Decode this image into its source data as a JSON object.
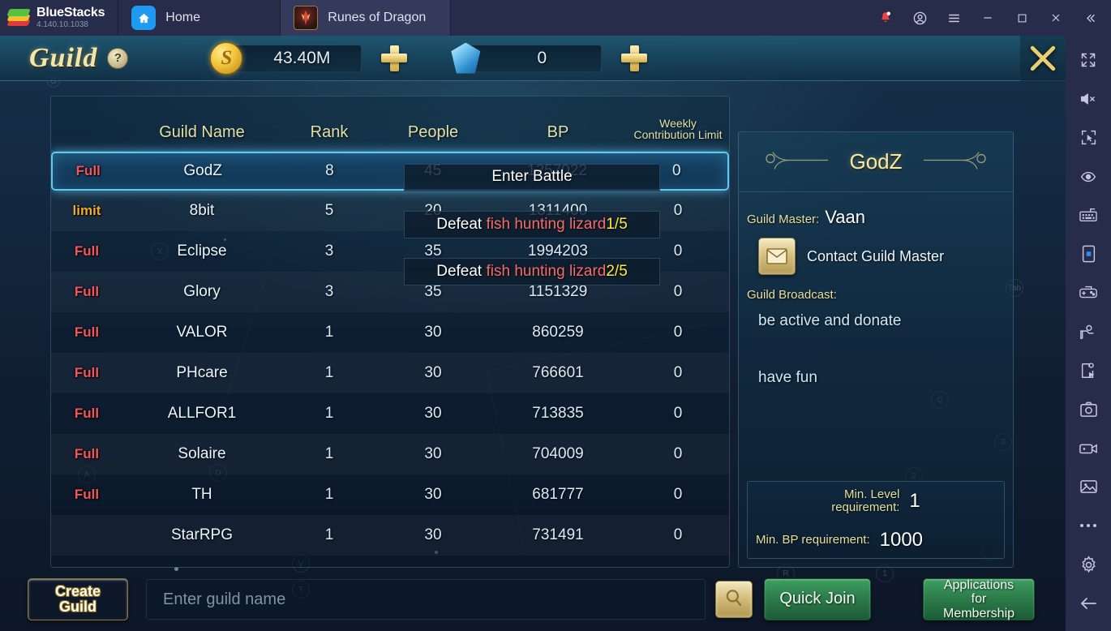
{
  "bluestacks": {
    "brand": "BlueStacks",
    "version": "4.140.10.1038",
    "tabs": [
      {
        "label": "Home",
        "icon": "home-icon",
        "active": false
      },
      {
        "label": "Runes of Dragon",
        "icon": "game-icon",
        "active": true
      }
    ],
    "window_controls": [
      {
        "name": "notifications-bell-icon",
        "glyph": "bell"
      },
      {
        "name": "account-icon",
        "glyph": "account"
      },
      {
        "name": "menu-icon",
        "glyph": "hamburger"
      },
      {
        "name": "minimize-button",
        "glyph": "minimize"
      },
      {
        "name": "maximize-button",
        "glyph": "maximize"
      },
      {
        "name": "close-button",
        "glyph": "close"
      },
      {
        "name": "collapse-sidebar-button",
        "glyph": "chevrons-left"
      }
    ]
  },
  "game_header": {
    "title": "Guild",
    "help_glyph": "?",
    "gold": {
      "icon": "gold-coin-icon",
      "value": "43.40M",
      "add_label": "+"
    },
    "gem": {
      "icon": "gem-icon",
      "value": "0",
      "add_label": "+"
    },
    "close_glyph": "X"
  },
  "quest_overlay": {
    "title": "Enter Battle",
    "lines": [
      {
        "prefix": "Defeat ",
        "target": "fish hunting lizard",
        "progress": "1/5"
      },
      {
        "prefix": "Defeat ",
        "target": "fish hunting lizard",
        "progress": "2/5"
      }
    ],
    "colors": {
      "prefix": "#ffffff",
      "target": "#f76a6a",
      "progress": "#ffe93d"
    }
  },
  "guild_list": {
    "headers": {
      "status": "",
      "name": "Guild Name",
      "rank": "Rank",
      "people": "People",
      "bp": "BP",
      "weekly": "Weekly\nContribution Limit",
      "weekly_line1": "Weekly",
      "weekly_line2": "Contribution Limit"
    },
    "rows": [
      {
        "status": "Full",
        "status_type": "full",
        "name": "GodZ",
        "rank": "8",
        "people": "45",
        "bp": "1257022",
        "weekly": "0",
        "selected": true
      },
      {
        "status": "limit",
        "status_type": "limit",
        "name": "8bit",
        "rank": "5",
        "people": "20",
        "bp": "1311400",
        "weekly": "0",
        "selected": false
      },
      {
        "status": "Full",
        "status_type": "full",
        "name": "Eclipse",
        "rank": "3",
        "people": "35",
        "bp": "1994203",
        "weekly": "0",
        "selected": false
      },
      {
        "status": "Full",
        "status_type": "full",
        "name": "Glory",
        "rank": "3",
        "people": "35",
        "bp": "1151329",
        "weekly": "0",
        "selected": false
      },
      {
        "status": "Full",
        "status_type": "full",
        "name": "VALOR",
        "rank": "1",
        "people": "30",
        "bp": "860259",
        "weekly": "0",
        "selected": false
      },
      {
        "status": "Full",
        "status_type": "full",
        "name": "PHcare",
        "rank": "1",
        "people": "30",
        "bp": "766601",
        "weekly": "0",
        "selected": false
      },
      {
        "status": "Full",
        "status_type": "full",
        "name": "ALLFOR1",
        "rank": "1",
        "people": "30",
        "bp": "713835",
        "weekly": "0",
        "selected": false
      },
      {
        "status": "Full",
        "status_type": "full",
        "name": "Solaire",
        "rank": "1",
        "people": "30",
        "bp": "704009",
        "weekly": "0",
        "selected": false
      },
      {
        "status": "Full",
        "status_type": "full",
        "name": "TH",
        "rank": "1",
        "people": "30",
        "bp": "681777",
        "weekly": "0",
        "selected": false
      },
      {
        "status": "",
        "status_type": "none",
        "name": "StarRPG",
        "rank": "1",
        "people": "30",
        "bp": "731491",
        "weekly": "0",
        "selected": false
      }
    ]
  },
  "info_panel": {
    "guild_name": "GodZ",
    "master_label": "Guild Master:",
    "master_name": "Vaan",
    "contact_label": "Contact Guild Master",
    "broadcast_label": "Guild Broadcast:",
    "broadcast_lines": [
      "be active and donate",
      "have fun"
    ],
    "min_level_label_line1": "Min. Level",
    "min_level_label_line2": "requirement:",
    "min_level_value": "1",
    "min_bp_label": "Min. BP requirement:",
    "min_bp_value": "1000"
  },
  "bottom_bar": {
    "create_guild_line1": "Create",
    "create_guild_line2": "Guild",
    "search_placeholder": "Enter guild name",
    "search_value": "",
    "search_icon": "magnifier-icon",
    "quick_join": "Quick Join",
    "applications_line1": "Applications for",
    "applications_line2": "Membership"
  },
  "sidebar": {
    "items": [
      {
        "name": "fullscreen-icon"
      },
      {
        "name": "mute-icon"
      },
      {
        "name": "cursor-select-icon"
      },
      {
        "name": "eye-icon"
      },
      {
        "name": "keyboard-controls-icon"
      },
      {
        "name": "tilt-device-icon"
      },
      {
        "name": "gamepad-icon"
      },
      {
        "name": "shooting-mode-icon"
      },
      {
        "name": "macro-script-icon"
      },
      {
        "name": "screenshot-icon"
      },
      {
        "name": "record-video-icon"
      },
      {
        "name": "media-gallery-icon"
      },
      {
        "name": "more-options-icon"
      },
      {
        "name": "settings-gear-icon"
      },
      {
        "name": "back-arrow-icon"
      }
    ]
  },
  "theme": {
    "accent_cyan": "#5fc8f5",
    "gold": "#f2eaa6",
    "full_red": "#f4565c",
    "limit_orange": "#efa92c",
    "green_button": "#2d7d4b",
    "bluestacks_bar": "#262c49"
  }
}
